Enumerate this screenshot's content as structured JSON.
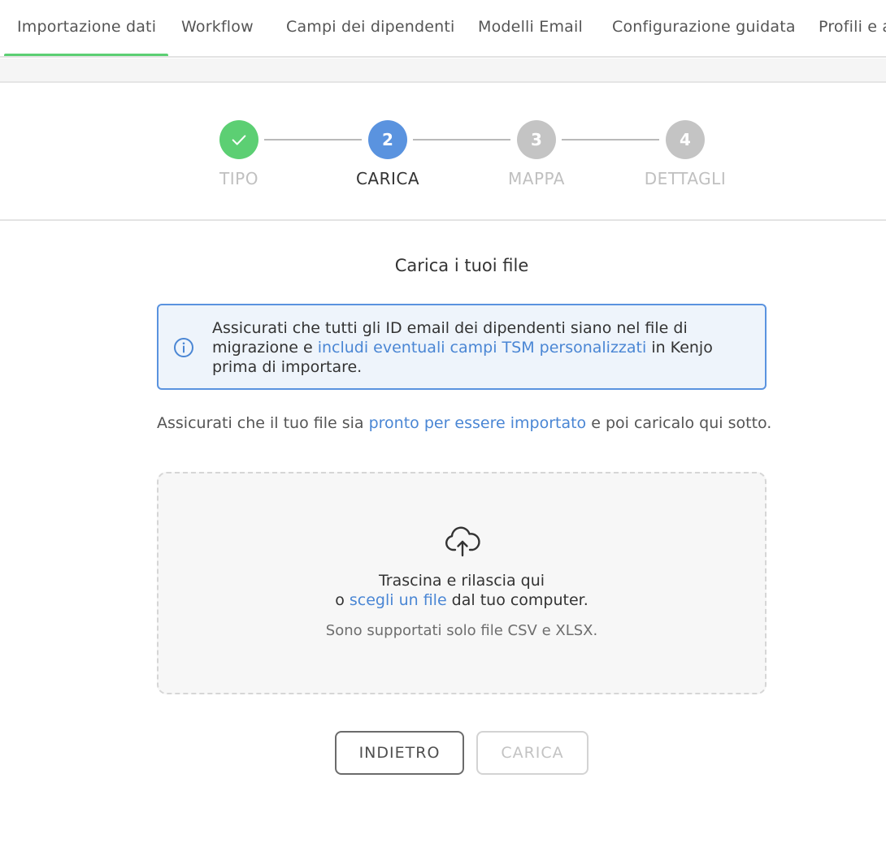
{
  "tabs": [
    {
      "label": "Importazione dati",
      "active": true
    },
    {
      "label": "Workflow",
      "active": false
    },
    {
      "label": "Campi dei dipendenti",
      "active": false
    },
    {
      "label": "Modelli Email",
      "active": false
    },
    {
      "label": "Configurazione guidata",
      "active": false
    },
    {
      "label": "Profili e a",
      "active": false
    }
  ],
  "stepper": {
    "steps": [
      {
        "number": "",
        "label": "TIPO",
        "state": "done"
      },
      {
        "number": "2",
        "label": "CARICA",
        "state": "current"
      },
      {
        "number": "3",
        "label": "MAPPA",
        "state": "pending"
      },
      {
        "number": "4",
        "label": "DETTAGLI",
        "state": "pending"
      }
    ]
  },
  "main": {
    "title": "Carica i tuoi file",
    "info": {
      "text_before": "Assicurati che tutti gli ID email dei dipendenti siano nel file di migrazione e ",
      "link": "includi eventuali campi TSM personalizzati",
      "text_after": " in Kenjo prima di importare."
    },
    "hint": {
      "text_before": "Assicurati che il tuo file sia ",
      "link": "pronto per essere importato",
      "text_after": " e poi caricalo qui sotto."
    },
    "dropzone": {
      "line1": "Trascina e rilascia qui",
      "line2_before": "o ",
      "line2_link": "scegli un file",
      "line2_after": " dal tuo computer.",
      "note": "Sono supportati solo file CSV e XLSX."
    },
    "buttons": {
      "back": "INDIETRO",
      "upload": "CARICA"
    }
  },
  "colors": {
    "accent_green": "#5ccf73",
    "accent_blue": "#5a93df",
    "pending_gray": "#c4c4c4"
  }
}
